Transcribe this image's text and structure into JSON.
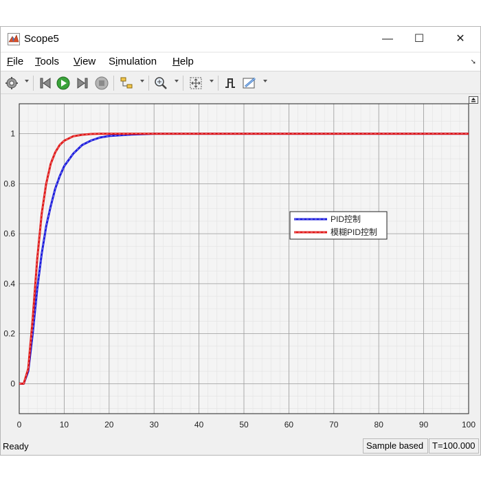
{
  "window": {
    "title": "Scope5"
  },
  "window_controls": {
    "minimize": "—",
    "maximize": "☐",
    "close": "✕"
  },
  "menu": {
    "items": [
      {
        "key": "file",
        "label": "File",
        "mnemonic": "F"
      },
      {
        "key": "tools",
        "label": "Tools",
        "mnemonic": "T"
      },
      {
        "key": "view",
        "label": "View",
        "mnemonic": "V"
      },
      {
        "key": "simulation",
        "label": "Simulation",
        "mnemonic": "i"
      },
      {
        "key": "help",
        "label": "Help",
        "mnemonic": "H"
      }
    ]
  },
  "toolbar": {
    "icons": [
      "gear-icon",
      "step-back-icon",
      "run-icon",
      "step-forward-icon",
      "stop-icon",
      "highlight-block-icon",
      "zoom-in-icon",
      "fit-to-view-icon",
      "triggers-icon",
      "measurements-icon"
    ]
  },
  "status": {
    "ready": "Ready",
    "mode": "Sample based",
    "time": "T=100.000"
  },
  "chart_data": {
    "type": "line",
    "xlim": [
      0,
      100
    ],
    "ylim": [
      -0.12,
      1.12
    ],
    "x_ticks": [
      0,
      10,
      20,
      30,
      40,
      50,
      60,
      70,
      80,
      90,
      100
    ],
    "y_ticks": [
      0,
      0.2,
      0.4,
      0.6,
      0.8,
      1
    ],
    "grid": true,
    "legend_position": "center-right",
    "series": [
      {
        "name": "PID控制",
        "color": "#1a1adc",
        "x": [
          0,
          1,
          2,
          3,
          4,
          5,
          6,
          7,
          8,
          9,
          10,
          12,
          14,
          16,
          18,
          20,
          25,
          30,
          40,
          50,
          60,
          70,
          80,
          90,
          100
        ],
        "y": [
          0,
          0,
          0.05,
          0.2,
          0.38,
          0.52,
          0.63,
          0.71,
          0.78,
          0.83,
          0.87,
          0.92,
          0.955,
          0.973,
          0.985,
          0.991,
          0.997,
          1,
          1,
          1,
          1,
          1,
          1,
          1,
          1
        ]
      },
      {
        "name": "模糊PID控制",
        "color": "#e01818",
        "x": [
          0,
          1,
          2,
          3,
          4,
          5,
          6,
          7,
          8,
          9,
          10,
          12,
          14,
          16,
          18,
          20,
          25,
          30,
          40,
          50,
          60,
          70,
          80,
          90,
          100
        ],
        "y": [
          0,
          0,
          0.06,
          0.26,
          0.5,
          0.68,
          0.8,
          0.88,
          0.925,
          0.955,
          0.972,
          0.99,
          0.996,
          0.999,
          1,
          1,
          1,
          1,
          1,
          1,
          1,
          1,
          1,
          1,
          1
        ]
      }
    ]
  }
}
